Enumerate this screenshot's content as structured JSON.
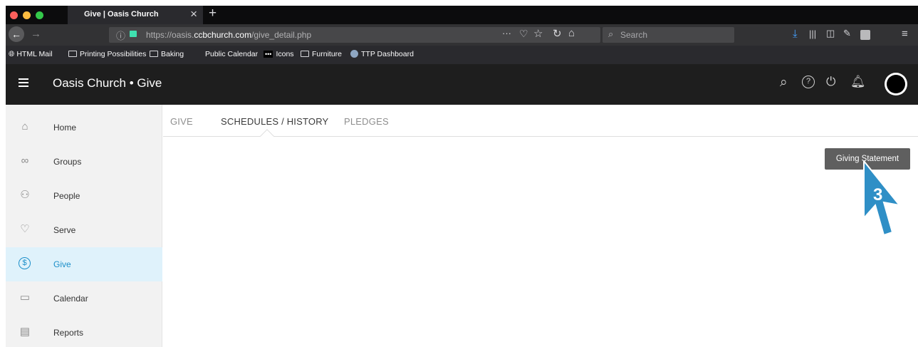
{
  "browser": {
    "tab_title": "Give | Oasis Church",
    "new_tab": "+",
    "close_tab": "×",
    "url_prefix": "https://oasis.",
    "url_host": "ccbchurch.com",
    "url_path": "/give_detail.php",
    "search_placeholder": "Search",
    "bookmarks": [
      "HTML Mail",
      "Printing Possibilities",
      "Baking",
      "Public Calendar",
      "Icons",
      "Furniture",
      "TTP Dashboard"
    ]
  },
  "app": {
    "title": "Oasis Church • Give"
  },
  "sidebar": {
    "items": [
      {
        "label": "Home",
        "icon": "home-icon"
      },
      {
        "label": "Groups",
        "icon": "groups-icon"
      },
      {
        "label": "People",
        "icon": "people-icon"
      },
      {
        "label": "Serve",
        "icon": "heart-icon"
      },
      {
        "label": "Give",
        "icon": "dollar-icon",
        "active": true
      },
      {
        "label": "Calendar",
        "icon": "calendar-icon"
      },
      {
        "label": "Reports",
        "icon": "reports-icon"
      }
    ]
  },
  "main": {
    "tabs": [
      "GIVE",
      "SCHEDULES / HISTORY",
      "PLEDGES"
    ],
    "active_tab": "SCHEDULES / HISTORY",
    "giving_statement_label": "Giving Statement"
  },
  "annotation": {
    "step_number": "3",
    "color": "#2f8fc6"
  }
}
